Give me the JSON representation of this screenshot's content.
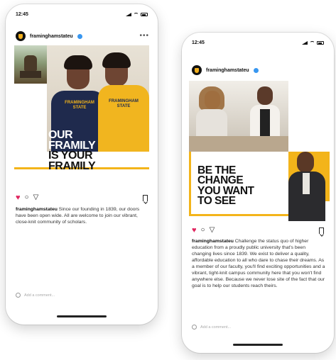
{
  "post1": {
    "time": "12:45",
    "username": "framinghamstateu",
    "headline": [
      "OUR",
      "FRAMILY",
      "IS YOUR",
      "FRAMILY"
    ],
    "sweatshirt_text_left": "FRAMINGHAM STATE",
    "sweatshirt_text_right": "FRAMINGHAM STATE",
    "caption_user": "framinghamstateu",
    "caption_text": " Since our founding in 1839, our doors have been open wide. All are welcome to join our vibrant, close-knit community of scholars.",
    "comment_placeholder": "Add a comment..."
  },
  "post2": {
    "time": "12:45",
    "username": "framinghamstateu",
    "headline": [
      "BE THE",
      "CHANGE",
      "YOU WANT",
      "TO SEE"
    ],
    "caption_user": "framinghamstateu",
    "caption_text": " Challenge the status quo of higher education from a proudly public university that's been changing lives since 1839. We exist to deliver a quality, affordable education to all who dare to chase their dreams. As a member of our faculty, you'll find exciting opportunities and a vibrant, tight-knit campus community here that you won't find anywhere else. Because we never lose site of the fact that our goal is to help our students reach theirs.",
    "comment_placeholder": "Add a comment..."
  },
  "colors": {
    "brand_gold": "#f3b41a",
    "brand_black": "#111111",
    "like_red": "#e0245e"
  }
}
